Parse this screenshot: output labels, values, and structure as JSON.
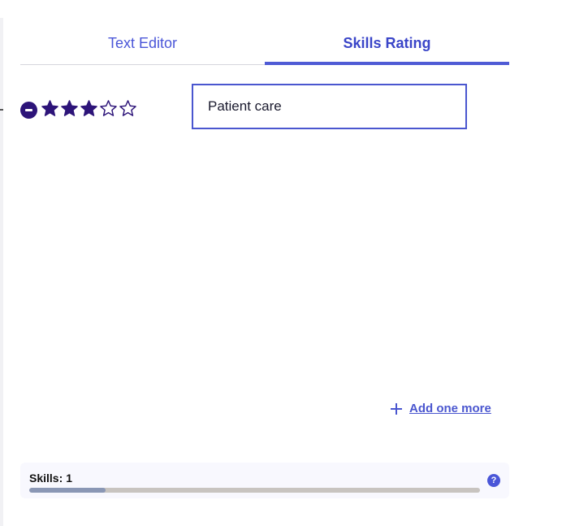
{
  "tabs": [
    {
      "label": "Text Editor",
      "active": false
    },
    {
      "label": "Skills Rating",
      "active": true
    }
  ],
  "skill": {
    "value": "Patient care",
    "rating": 3,
    "max_rating": 5
  },
  "add_more_label": "Add one more",
  "skills_meter": {
    "label": "Skills:",
    "count": "1",
    "progress": 0.17
  },
  "help_glyph": "?",
  "colors": {
    "accent": "#4a56cf",
    "star_fill": "#2d1479",
    "remove_button": "#2d1479",
    "progress_fill": "#8a97b5",
    "progress_track": "#c8c4c0"
  },
  "icons": {
    "remove": "minus-circle-icon",
    "star_filled": "star-filled-icon",
    "star_empty": "star-outline-icon",
    "add": "plus-icon",
    "help": "question-circle-icon"
  }
}
